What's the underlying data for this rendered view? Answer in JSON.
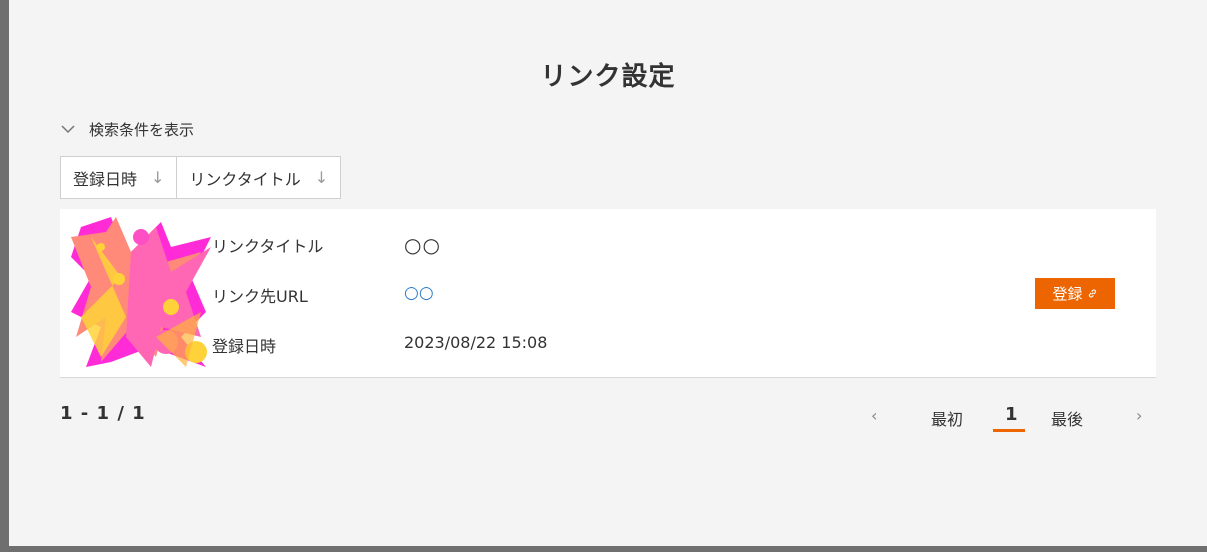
{
  "modal": {
    "title": "リンク設定"
  },
  "search": {
    "toggle_label": "検索条件を表示"
  },
  "sort": {
    "buttons": [
      {
        "label": "登録日時",
        "arrow": "↓"
      },
      {
        "label": "リンクタイトル",
        "arrow": "↓"
      }
    ]
  },
  "item": {
    "title_label": "リンクタイトル",
    "title_value": "○○",
    "url_label": "リンク先URL",
    "url_value": "○○",
    "date_label": "登録日時",
    "date_value": "2023/08/22 15:08",
    "register_label": "登録"
  },
  "pagination": {
    "count": "1 - 1 / 1",
    "prev": "‹",
    "first": "最初",
    "current": "1",
    "last": "最後",
    "next": "›"
  },
  "colors": {
    "accent": "#ec6500",
    "link": "#2a7ac8"
  }
}
